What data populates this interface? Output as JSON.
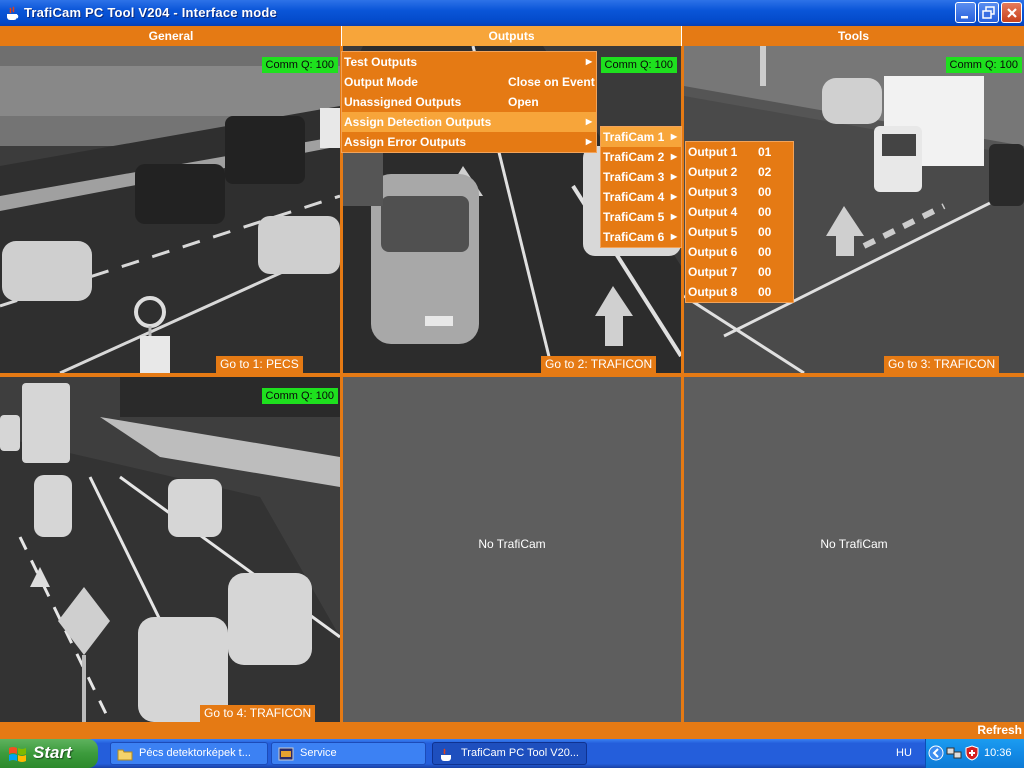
{
  "window": {
    "title": "TrafiCam PC Tool V204 - Interface mode"
  },
  "menu": {
    "tabs": [
      {
        "label": "General"
      },
      {
        "label": "Outputs"
      },
      {
        "label": "Tools"
      }
    ]
  },
  "outputs_menu": {
    "items": [
      {
        "label": "Test Outputs",
        "value": ""
      },
      {
        "label": "Output Mode",
        "value": "Close on Event"
      },
      {
        "label": "Unassigned Outputs",
        "value": "Open"
      },
      {
        "label": "Assign Detection Outputs",
        "value": ""
      },
      {
        "label": "Assign Error Outputs",
        "value": ""
      }
    ]
  },
  "traficam_submenu": {
    "items": [
      {
        "label": "TrafiCam 1"
      },
      {
        "label": "TrafiCam 2"
      },
      {
        "label": "TrafiCam 3"
      },
      {
        "label": "TrafiCam 4"
      },
      {
        "label": "TrafiCam 5"
      },
      {
        "label": "TrafiCam 6"
      }
    ]
  },
  "output_submenu": {
    "items": [
      {
        "label": "Output 1",
        "value": "01"
      },
      {
        "label": "Output 2",
        "value": "02"
      },
      {
        "label": "Output 3",
        "value": "00"
      },
      {
        "label": "Output 4",
        "value": "00"
      },
      {
        "label": "Output 5",
        "value": "00"
      },
      {
        "label": "Output 6",
        "value": "00"
      },
      {
        "label": "Output 7",
        "value": "00"
      },
      {
        "label": "Output 8",
        "value": "00"
      }
    ]
  },
  "cameras": [
    {
      "comm": "Comm Q: 100",
      "goto": "Go to 1: PECS"
    },
    {
      "comm": "Comm Q: 100",
      "goto": "Go to 2: TRAFICON"
    },
    {
      "comm": "Comm Q: 100",
      "goto": "Go to 3: TRAFICON"
    },
    {
      "comm": "Comm Q: 100",
      "goto": "Go to 4: TRAFICON"
    },
    {
      "empty_text": "No TrafiCam"
    },
    {
      "empty_text": "No TrafiCam"
    }
  ],
  "statusbar": {
    "refresh_label": "Refresh"
  },
  "taskbar": {
    "start_label": "Start",
    "tasks": [
      {
        "label": "Pécs detektorképek t...",
        "icon": "folder-icon"
      },
      {
        "label": "Service",
        "icon": "service-icon"
      },
      {
        "label": "TrafiCam PC Tool V20...",
        "icon": "java-icon"
      }
    ],
    "language": "HU",
    "clock": "10:36"
  },
  "colors": {
    "accent": "#e57a14",
    "highlight": "#f7a53a",
    "comm_ok": "#1ee01e",
    "panel_bg": "#5e5e5e"
  }
}
